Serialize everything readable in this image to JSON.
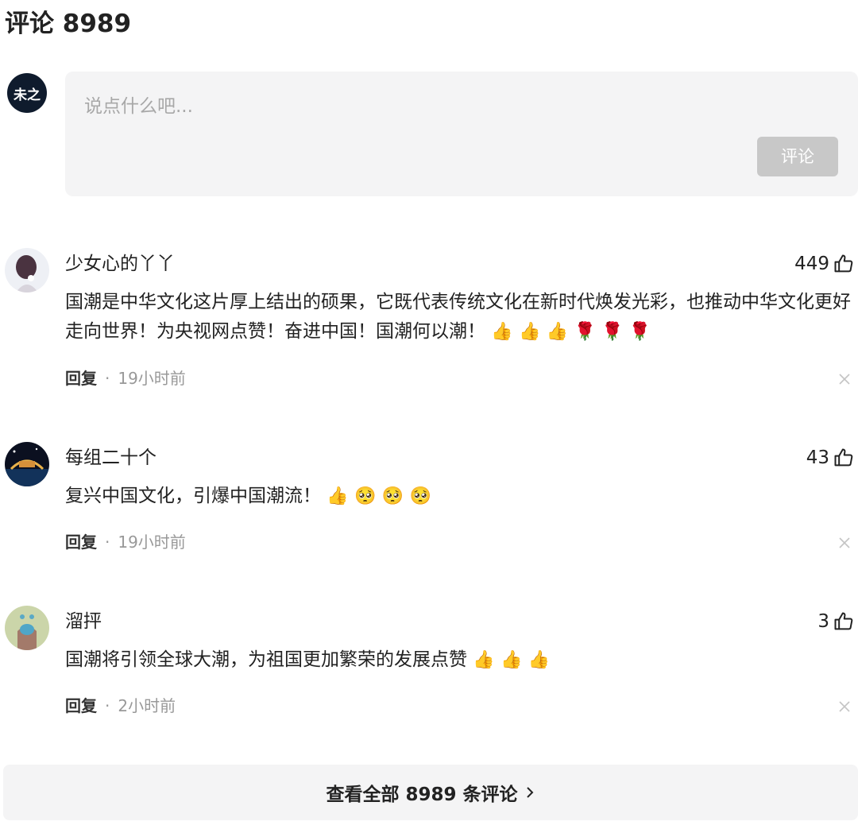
{
  "header": {
    "title": "评论 8989"
  },
  "composer": {
    "avatar_text": "未之",
    "placeholder": "说点什么吧...",
    "submit_label": "评论"
  },
  "comments": [
    {
      "username": "少女心的丫丫",
      "likes": "449",
      "text": "国潮是中华文化这片厚上结出的硕果，它既代表传统文化在新时代焕发光彩，也推动中华文化更好走向世界！为央视网点赞！奋进中国！国潮何以潮！",
      "emojis": [
        "👍",
        "👍",
        "👍",
        "🌹",
        "🌹",
        "🌹"
      ],
      "reply_label": "回复",
      "separator": "·",
      "time": "19小时前"
    },
    {
      "username": "每组二十个",
      "likes": "43",
      "text": "复兴中国文化，引爆中国潮流！",
      "emojis": [
        "👍",
        "🥺",
        "🥺",
        "🥺"
      ],
      "reply_label": "回复",
      "separator": "·",
      "time": "19小时前"
    },
    {
      "username": "溜抨",
      "likes": "3",
      "text": "国潮将引领全球大潮，为祖国更加繁荣的发展点赞",
      "emojis": [
        "👍",
        "👍",
        "👍"
      ],
      "reply_label": "回复",
      "separator": "·",
      "time": "2小时前"
    }
  ],
  "view_all": {
    "label": "查看全部 8989 条评论"
  },
  "colors": {
    "panel_bg": "#f4f4f5",
    "button_disabled": "#c8c8c8",
    "muted_text": "#999999",
    "primary_text": "#222222"
  }
}
